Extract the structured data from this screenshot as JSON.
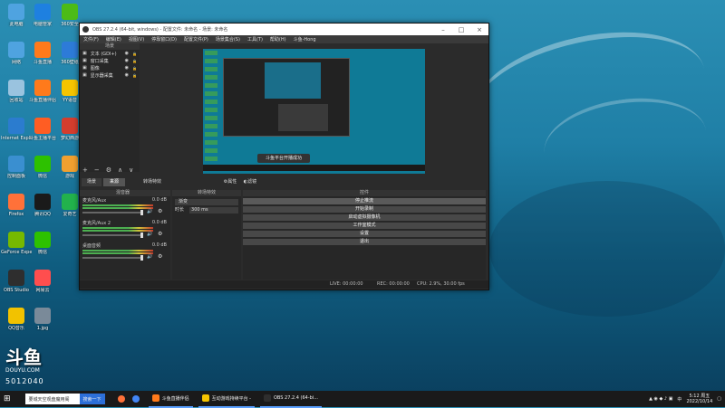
{
  "desktop": {
    "icons": [
      {
        "label": "此电脑",
        "icon": "computer-icon",
        "color": "#4fa3e0"
      },
      {
        "label": "网络",
        "icon": "network-icon",
        "color": "#4fa3e0"
      },
      {
        "label": "回收站",
        "icon": "recycle-bin-icon",
        "color": "#9ac3df"
      },
      {
        "label": "Internet Explorer",
        "icon": "ie-icon",
        "color": "#2b7ccf"
      },
      {
        "label": "控制面板",
        "icon": "control-panel-icon",
        "color": "#3a8fd0"
      },
      {
        "label": "Firefox",
        "icon": "firefox-icon",
        "color": "#ff7139"
      },
      {
        "label": "GeForce Experience",
        "icon": "nvidia-icon",
        "color": "#76b900"
      },
      {
        "label": "OBS Studio",
        "icon": "obs-icon",
        "color": "#2e2e2e"
      },
      {
        "label": "QQ音乐",
        "icon": "qqmusic-icon",
        "color": "#f2c200"
      },
      {
        "label": "电脑管家",
        "icon": "pc-manager-icon",
        "color": "#1e80e0"
      },
      {
        "label": "斗鱼直播",
        "icon": "douyu-icon",
        "color": "#ff7a1b"
      },
      {
        "label": "斗鱼直播伴侣",
        "icon": "douyu-assistant-icon",
        "color": "#ff7a1b"
      },
      {
        "label": "斗鱼主播平台",
        "icon": "douyu-platform-icon",
        "color": "#ff5d23"
      },
      {
        "label": "微信",
        "icon": "wechat-icon",
        "color": "#2dc100"
      },
      {
        "label": "腾讯QQ",
        "icon": "qq-icon",
        "color": "#1a1a1a"
      },
      {
        "label": "微信",
        "icon": "wechat-icon",
        "color": "#2dc100"
      },
      {
        "label": "网易云",
        "icon": "netease-icon",
        "color": "#ff4e4e"
      },
      {
        "label": "1.jpg",
        "icon": "image-file-icon",
        "color": "#7a8a99"
      },
      {
        "label": "360安全",
        "icon": "360-icon",
        "color": "#4cbb17"
      },
      {
        "label": "360壁纸",
        "icon": "360-wallpaper-icon",
        "color": "#2d7bd8"
      },
      {
        "label": "YY语音",
        "icon": "yy-icon",
        "color": "#f5c400"
      },
      {
        "label": "梦幻西游",
        "icon": "game-icon",
        "color": "#d43d2e"
      },
      {
        "label": "游戏",
        "icon": "game-icon",
        "color": "#f0a030"
      },
      {
        "label": "爱奇艺",
        "icon": "iqiyi-icon",
        "color": "#22b24c"
      }
    ],
    "douyu_logo": "斗鱼",
    "douyu_url": "DOUYU.COM",
    "room_id": "5012040"
  },
  "obs": {
    "title": "OBS 27.2.4 (64-bit, windows) - 配置文件: 未命名 - 场景: 未命名",
    "menu": [
      "文件(F)",
      "编辑(E)",
      "视图(V)",
      "停靠窗口(D)",
      "配置文件(P)",
      "场景集合(S)",
      "工具(T)",
      "帮助(H)",
      "斗鱼-Hong"
    ],
    "scenes_header": "场景",
    "sources": [
      {
        "label": "文本 (GDI+)"
      },
      {
        "label": "窗口采集"
      },
      {
        "label": "图像"
      },
      {
        "label": "显示器采集"
      }
    ],
    "toast": "斗鱼平台开播成功",
    "tabs": {
      "scenes": "场景",
      "sources": "来源",
      "transitions": "转场特效"
    },
    "toolbar": {
      "properties": "属性",
      "filters": "滤镜"
    },
    "mixer_header": "混音器",
    "mixer": [
      {
        "name": "麦克风/Aux",
        "db": "0.0 dB"
      },
      {
        "name": "麦克风/Aux 2",
        "db": "0.0 dB"
      },
      {
        "name": "桌面音频",
        "db": "0.0 dB"
      }
    ],
    "transition_header": "转场特效",
    "transition_value": "渐变",
    "duration_label": "时长",
    "duration_value": "300 ms",
    "controls_header": "控件",
    "controls": [
      "停止推流",
      "开始录制",
      "启动虚拟摄像机",
      "工作室模式",
      "设置",
      "退出"
    ],
    "status": {
      "live": "LIVE: 00:00:00",
      "rec": "REC: 00:00:00",
      "cpu": "CPU: 2.9%, 30.00 fps"
    }
  },
  "taskbar": {
    "search_text": "要城天空观盘魔用阁",
    "search_button": "搜索一下",
    "apps": [
      {
        "label": "斗鱼直播伴侣"
      },
      {
        "label": "互动游戏持续平台 -"
      },
      {
        "label": "OBS 27.2.4 (64-bi..."
      }
    ],
    "time": "5:12 周五",
    "date": "2022/10/14",
    "lang": "中"
  }
}
